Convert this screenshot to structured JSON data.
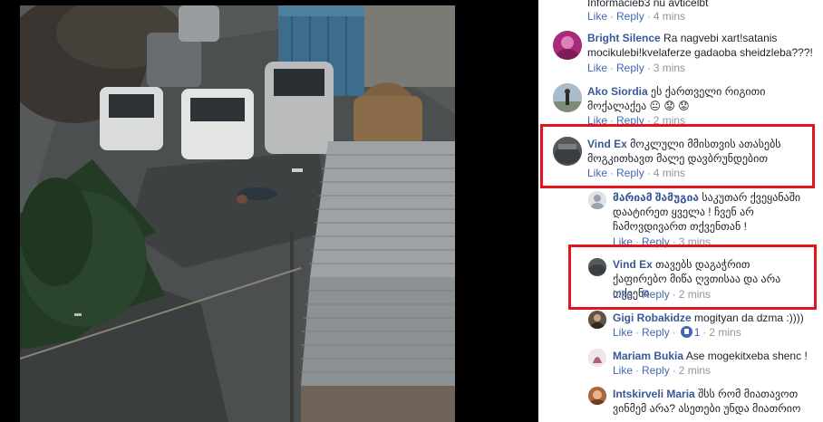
{
  "photo": {
    "alt": "courtyard photo"
  },
  "actions": {
    "like": "Like",
    "reply": "Reply",
    "dot": "·"
  },
  "comments": [
    {
      "author": "",
      "text": "Informacieb3 nu avticelbt",
      "time": "4 mins"
    },
    {
      "author": "Bright Silence",
      "text": "Ra nagvebi xart!satanis mocikulebi!kvelaferze gadaoba sheidzleba???!",
      "time": "3 mins"
    },
    {
      "author": "Ako Siordia",
      "text": "ეს ქართველი რიგითი მოქალაქეა 😐 😟 😟",
      "time": "2 mins"
    },
    {
      "author": "Vind Ex",
      "text": "მოკლული მმისთვის ათასებს მოგკითხავთ მალე დავბრუნდებით",
      "time": "4 mins"
    },
    {
      "author": "მარიამ შამუგია",
      "text": "საკუთარ ქვეყანაში დაატირეთ ყველა ! ჩვენ არ ჩამოვდივართ თქვენთან !",
      "time": "3 mins"
    },
    {
      "author": "Vind Ex",
      "text": "თავებს დაგაჭრით ქაფირებო მიწა ღვთისაა და არა თქვენი",
      "time": "2 mins"
    },
    {
      "author": "Gigi Robakidze",
      "text": "mogityan da dzma :))))",
      "time": "2 mins",
      "likes": "1"
    },
    {
      "author": "Mariam Bukia",
      "text": "Ase mogekitxeba shenc !",
      "time": "2 mins"
    },
    {
      "author": "Intskirveli Maria",
      "text": "შსს რომ მიათავოთ ვინმემ არა? ასეთები უნდა მიათრიო",
      "time": ""
    }
  ]
}
